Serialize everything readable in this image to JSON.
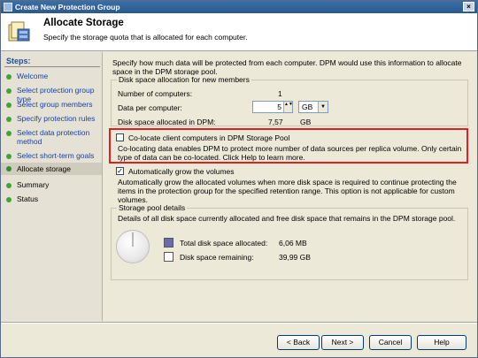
{
  "window": {
    "title": "Create New Protection Group",
    "close_glyph": "×"
  },
  "header": {
    "title": "Allocate Storage",
    "subtitle": "Specify the storage quota that is allocated for each computer."
  },
  "sidebar": {
    "title": "Steps:",
    "items": [
      {
        "label": "Welcome"
      },
      {
        "label": "Select protection group type"
      },
      {
        "label": "Select group members"
      },
      {
        "label": "Specify protection rules"
      },
      {
        "label": "Select data protection method"
      },
      {
        "label": "Select short-term goals"
      },
      {
        "label": "Allocate storage"
      },
      {
        "label": "Summary"
      },
      {
        "label": "Status"
      }
    ]
  },
  "main": {
    "intro": "Specify how much data will be protected from each computer. DPM would use this information to allocate space in the DPM storage pool.",
    "disk_alloc": {
      "legend": "Disk space allocation for new members",
      "num_computers_label": "Number of computers:",
      "num_computers_value": "1",
      "data_per_computer_label": "Data per computer:",
      "data_per_computer_value": "5",
      "unit": "GB",
      "allocated_label": "Disk space allocated in DPM:",
      "allocated_value": "7,57",
      "allocated_unit": "GB"
    },
    "colocate": {
      "label": "Co-locate client computers in DPM Storage Pool",
      "description": "Co-locating data enables DPM to protect more number of data sources per replica volume. Only certain type of data can be co-located. Click Help to learn more.",
      "checked": false
    },
    "autogrow": {
      "label": "Automatically grow the volumes",
      "description": "Automatically grow the allocated volumes when more disk space is required to continue protecting the items in the protection group for the specified retention range. This option is not applicable for custom volumes.",
      "checked": true,
      "check_glyph": "✓"
    },
    "pool": {
      "legend": "Storage pool details",
      "description": "Details of all disk space currently allocated and free disk space that remains in the DPM storage pool.",
      "total_label": "Total disk space allocated:",
      "total_value": "6,06 MB",
      "remaining_label": "Disk space remaining:",
      "remaining_value": "39,99 GB",
      "allocated_color": "#6b6ba8",
      "remaining_color": "#ffffff"
    }
  },
  "buttons": {
    "back": "< Back",
    "next": "Next >",
    "cancel": "Cancel",
    "help": "Help"
  },
  "icons": {
    "spin": "▲▼",
    "dropdown": "▼"
  }
}
